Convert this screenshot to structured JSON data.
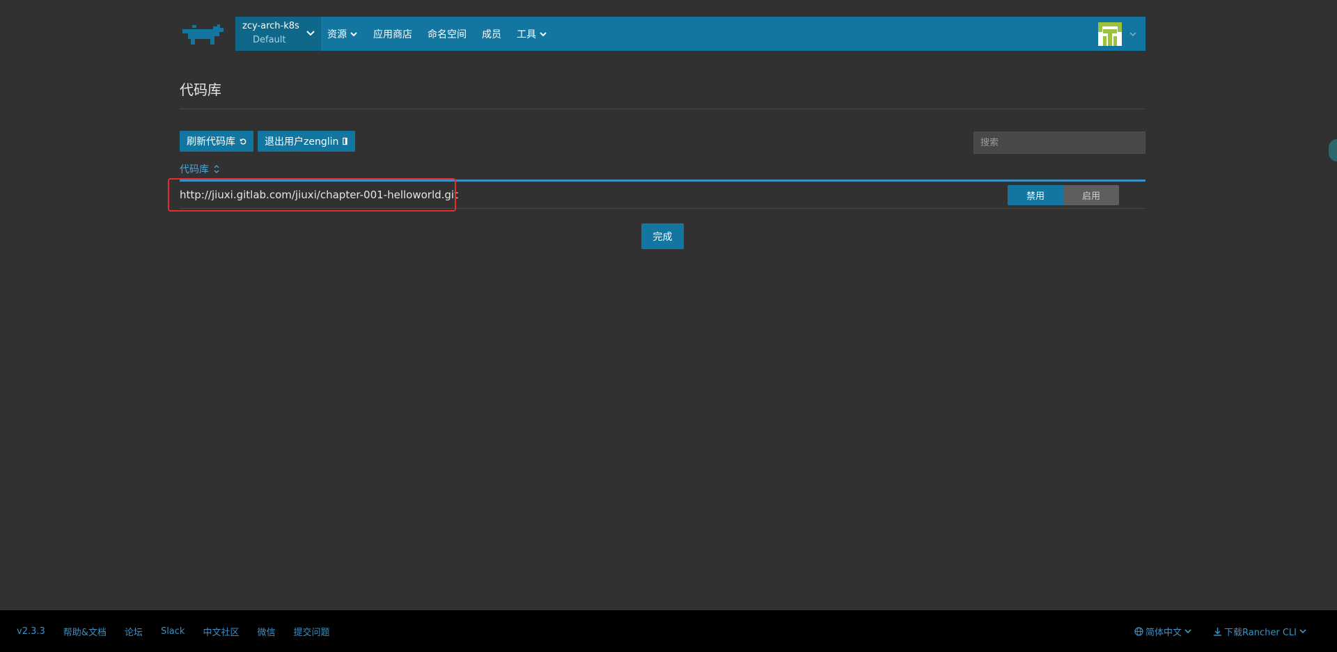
{
  "header": {
    "cluster_name": "zcy-arch-k8s",
    "project_name": "Default",
    "nav": [
      {
        "label": "资源",
        "has_dropdown": true
      },
      {
        "label": "应用商店",
        "has_dropdown": false
      },
      {
        "label": "命名空间",
        "has_dropdown": false
      },
      {
        "label": "成员",
        "has_dropdown": false
      },
      {
        "label": "工具",
        "has_dropdown": true
      }
    ],
    "brand_color": "#1276a0"
  },
  "page": {
    "title": "代码库",
    "refresh_button": "刷新代码库",
    "logout_button": "退出用户zenglin",
    "search_placeholder": "搜索",
    "column_header": "代码库",
    "repositories": [
      {
        "url": "http://jiuxi.gitlab.com/jiuxi/chapter-001-helloworld.git",
        "disable_label": "禁用",
        "enable_label": "启用",
        "state": "disabled"
      }
    ],
    "done_button": "完成"
  },
  "footer": {
    "version": "v2.3.3",
    "links": [
      "帮助&文档",
      "论坛",
      "Slack",
      "中文社区",
      "微信",
      "提交问题"
    ],
    "language": "简体中文",
    "download_cli": "下载Rancher CLI"
  },
  "colors": {
    "background": "#313131",
    "accent": "#1276a0",
    "link": "#3d8fc2",
    "highlight": "#e52d2d"
  }
}
